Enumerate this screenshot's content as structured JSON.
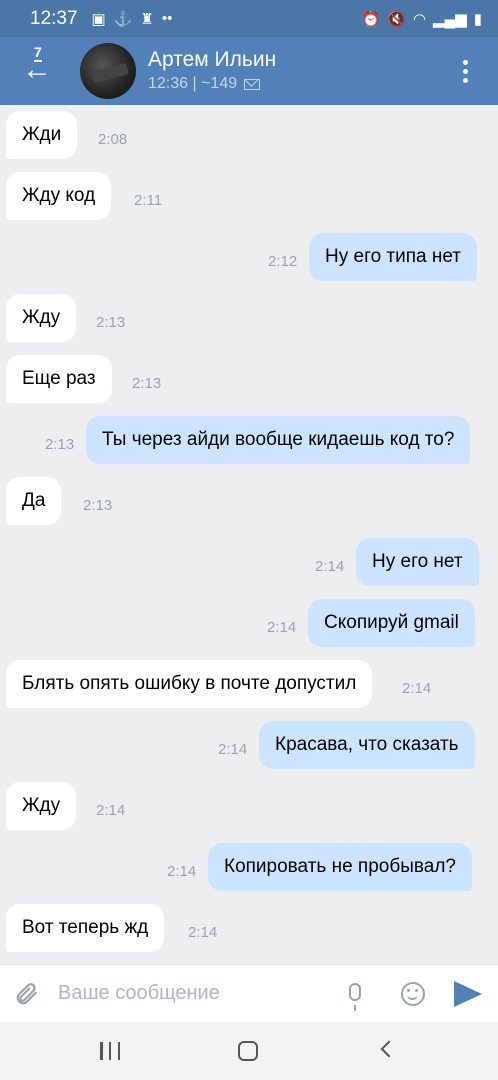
{
  "status_bar": {
    "time": "12:37",
    "left_icons": [
      "image-icon",
      "anchor-icon",
      "game-icon",
      "more-dots-icon"
    ],
    "right_icons": [
      "alarm-icon",
      "mute-icon",
      "wifi-icon",
      "signal-icon",
      "battery-icon"
    ]
  },
  "header": {
    "back_badge": "7",
    "name": "Артем Ильин",
    "subtitle": "12:36 | ~149",
    "colors": {
      "bar": "#5181b8",
      "status": "#4a76a8"
    }
  },
  "messages": [
    {
      "dir": "in",
      "text": "Жди",
      "time": "2:08"
    },
    {
      "dir": "in",
      "text": "Жду код",
      "time": "2:11"
    },
    {
      "dir": "out",
      "text": "Ну его типа нет",
      "time": "2:12"
    },
    {
      "dir": "in",
      "text": "Жду",
      "time": "2:13"
    },
    {
      "dir": "in",
      "text": "Еще раз",
      "time": "2:13"
    },
    {
      "dir": "out",
      "text": "Ты через айди вообще кидаешь код то?",
      "time": "2:13"
    },
    {
      "dir": "in",
      "text": "Да",
      "time": "2:13"
    },
    {
      "dir": "out",
      "text": "Ну его нет",
      "time": "2:14"
    },
    {
      "dir": "out",
      "text": "Скопируй gmail",
      "time": "2:14"
    },
    {
      "dir": "in",
      "text": "Блять опять ошибку в почте допустил",
      "time": "2:14"
    },
    {
      "dir": "out",
      "text": "Красава, что сказать",
      "time": "2:14"
    },
    {
      "dir": "in",
      "text": "Жду",
      "time": "2:14"
    },
    {
      "dir": "out",
      "text": "Копировать не пробывал?",
      "time": "2:14"
    },
    {
      "dir": "in",
      "text": "Вот теперь жд",
      "time": "2:14"
    }
  ],
  "composer": {
    "placeholder": "Ваше сообщение"
  },
  "colors": {
    "background": "#edeef0",
    "incoming_bubble": "#ffffff",
    "outgoing_bubble": "#cce4ff",
    "accent": "#5181b8"
  }
}
